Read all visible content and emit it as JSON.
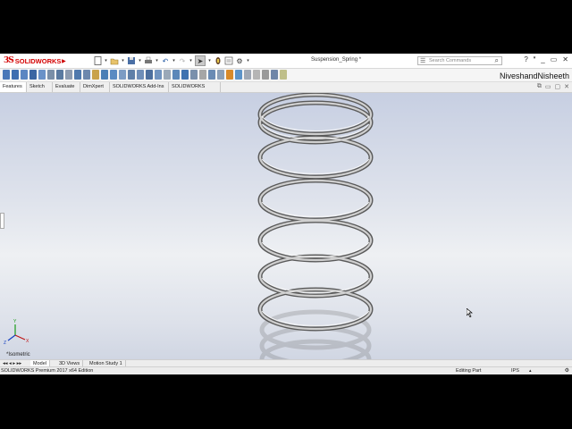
{
  "app": {
    "logo_ds": "3S",
    "logo_text": "SOLIDWORKS",
    "document_title": "Suspension_Spring *",
    "search_placeholder": "Search Commands",
    "user_name": "NiveshandNisheeth"
  },
  "title_toolbar": {
    "icons": [
      "new-icon",
      "open-icon",
      "save-icon",
      "print-icon",
      "undo-icon",
      "redo-icon",
      "select-icon",
      "rebuild-icon",
      "file-properties-icon",
      "options-icon"
    ]
  },
  "tabs": [
    "Features",
    "Sketch",
    "Evaluate",
    "DimXpert",
    "SOLIDWORKS Add-Ins",
    "SOLIDWORKS MBD"
  ],
  "active_tab": "Features",
  "viewport": {
    "view_label": "*Isometric"
  },
  "bottom_tabs": [
    "Model",
    "3D Views",
    "Motion Study 1"
  ],
  "active_bottom_tab": "Model",
  "status": {
    "edition": "SOLIDWORKS Premium 2017 x64 Edition",
    "mode": "Editing Part",
    "units": "IPS"
  },
  "colors": {
    "brand": "#d40000",
    "viewport_top": "#c7cfe2",
    "viewport_mid": "#eef0f3"
  }
}
